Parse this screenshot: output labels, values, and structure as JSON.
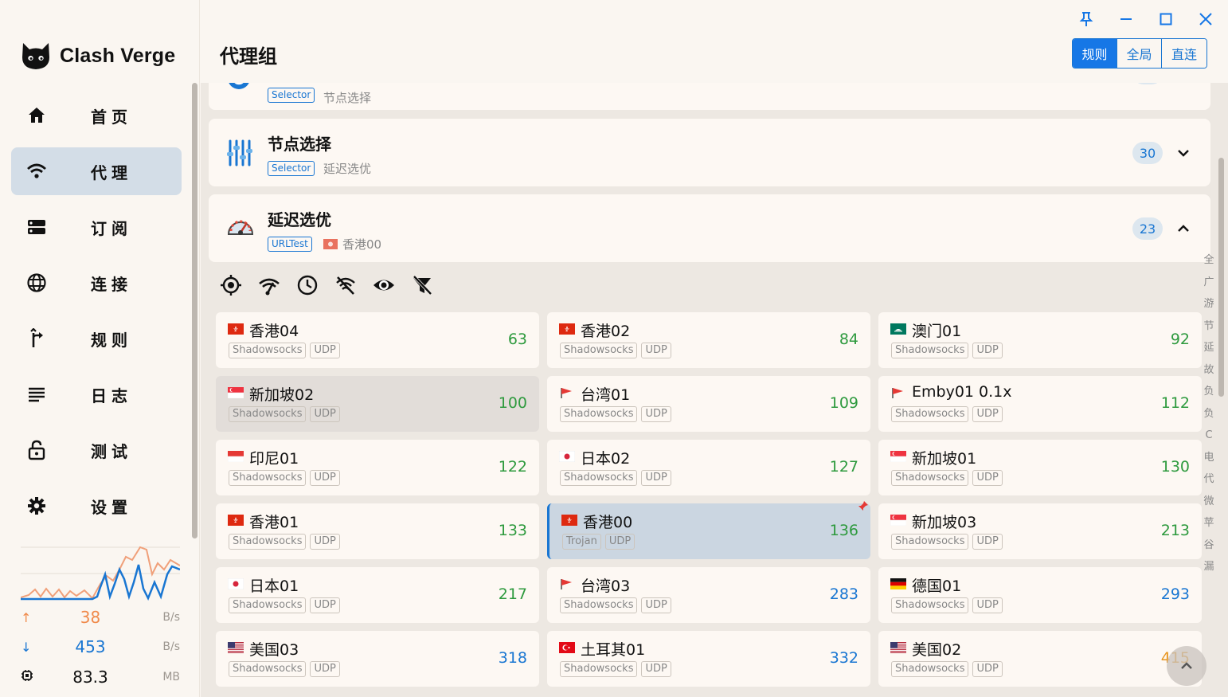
{
  "app": {
    "name": "Clash Verge"
  },
  "page_title": "代理组",
  "window_controls": {
    "pin": "pin-icon",
    "minimize": "minimize-icon",
    "maximize": "maximize-icon",
    "close": "close-icon"
  },
  "modes": [
    {
      "label": "规则",
      "active": true
    },
    {
      "label": "全局",
      "active": false
    },
    {
      "label": "直连",
      "active": false
    }
  ],
  "nav": [
    {
      "label": "首页",
      "icon": "home-icon"
    },
    {
      "label": "代理",
      "icon": "wifi-icon",
      "active": true
    },
    {
      "label": "订阅",
      "icon": "storage-icon"
    },
    {
      "label": "连接",
      "icon": "globe-icon"
    },
    {
      "label": "规则",
      "icon": "fork-icon"
    },
    {
      "label": "日志",
      "icon": "list-icon"
    },
    {
      "label": "测试",
      "icon": "lock-icon"
    },
    {
      "label": "设置",
      "icon": "gear-icon"
    }
  ],
  "stats": {
    "upload": {
      "value": "38",
      "unit": "B/s",
      "color": "#f08a4b"
    },
    "download": {
      "value": "453",
      "unit": "B/s",
      "color": "#1976d2"
    },
    "memory": {
      "value": "83.3",
      "unit": "MB"
    }
  },
  "groups": [
    {
      "name": "",
      "type": "Selector",
      "now": "节点选择",
      "count": ""
    },
    {
      "name": "节点选择",
      "type": "Selector",
      "now": "延迟选优",
      "count": "30",
      "expanded": false
    },
    {
      "name": "延迟选优",
      "type": "URLTest",
      "now": "香港00",
      "count": "23",
      "expanded": true
    }
  ],
  "toolbar": [
    "locate-icon",
    "network-check-icon",
    "clock-icon",
    "wifi-off-icon",
    "eye-icon",
    "filter-off-icon"
  ],
  "proxies": [
    {
      "name": "香港04",
      "flag": "hk",
      "type": "Shadowsocks",
      "udp": "UDP",
      "delay": "63",
      "color": "#2e9a3e"
    },
    {
      "name": "香港02",
      "flag": "hk",
      "type": "Shadowsocks",
      "udp": "UDP",
      "delay": "84",
      "color": "#2e9a3e"
    },
    {
      "name": "澳门01",
      "flag": "mo",
      "type": "Shadowsocks",
      "udp": "UDP",
      "delay": "92",
      "color": "#2e9a3e"
    },
    {
      "name": "新加坡02",
      "flag": "sg",
      "type": "Shadowsocks",
      "udp": "UDP",
      "delay": "100",
      "color": "#2e9a3e",
      "hover": true
    },
    {
      "name": "台湾01",
      "flag": "red",
      "type": "Shadowsocks",
      "udp": "UDP",
      "delay": "109",
      "color": "#2e9a3e"
    },
    {
      "name": "Emby01 0.1x",
      "flag": "red",
      "type": "Shadowsocks",
      "udp": "UDP",
      "delay": "112",
      "color": "#2e9a3e"
    },
    {
      "name": "印尼01",
      "flag": "id",
      "type": "Shadowsocks",
      "udp": "UDP",
      "delay": "122",
      "color": "#2e9a3e"
    },
    {
      "name": "日本02",
      "flag": "jp",
      "type": "Shadowsocks",
      "udp": "UDP",
      "delay": "127",
      "color": "#2e9a3e"
    },
    {
      "name": "新加坡01",
      "flag": "sg",
      "type": "Shadowsocks",
      "udp": "UDP",
      "delay": "130",
      "color": "#2e9a3e"
    },
    {
      "name": "香港01",
      "flag": "hk",
      "type": "Shadowsocks",
      "udp": "UDP",
      "delay": "133",
      "color": "#2e9a3e"
    },
    {
      "name": "香港00",
      "flag": "hk",
      "type": "Trojan",
      "udp": "UDP",
      "delay": "136",
      "color": "#2e9a3e",
      "selected": true
    },
    {
      "name": "新加坡03",
      "flag": "sg",
      "type": "Shadowsocks",
      "udp": "UDP",
      "delay": "213",
      "color": "#2e9a3e"
    },
    {
      "name": "日本01",
      "flag": "jp",
      "type": "Shadowsocks",
      "udp": "UDP",
      "delay": "217",
      "color": "#2e9a3e"
    },
    {
      "name": "台湾03",
      "flag": "red",
      "type": "Shadowsocks",
      "udp": "UDP",
      "delay": "283",
      "color": "#1976d2"
    },
    {
      "name": "德国01",
      "flag": "de",
      "type": "Shadowsocks",
      "udp": "UDP",
      "delay": "293",
      "color": "#1976d2"
    },
    {
      "name": "美国03",
      "flag": "us",
      "type": "Shadowsocks",
      "udp": "UDP",
      "delay": "318",
      "color": "#1976d2"
    },
    {
      "name": "土耳其01",
      "flag": "tr",
      "type": "Shadowsocks",
      "udp": "UDP",
      "delay": "332",
      "color": "#1976d2"
    },
    {
      "name": "美国02",
      "flag": "us",
      "type": "Shadowsocks",
      "udp": "UDP",
      "delay": "415",
      "color": "#e8951e"
    }
  ],
  "alpha_index": [
    "全",
    "广",
    "游",
    "节",
    "延",
    "故",
    "负",
    "负",
    "C",
    "电",
    "代",
    "微",
    "苹",
    "谷",
    "漏"
  ]
}
